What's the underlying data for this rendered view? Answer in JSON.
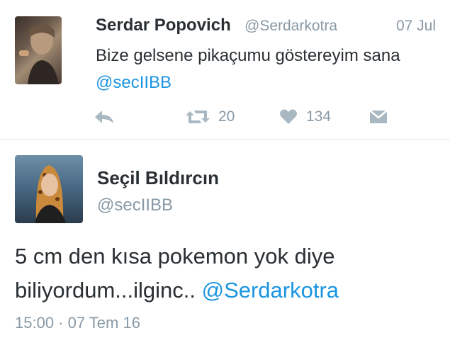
{
  "tweet1": {
    "name": "Serdar Popovich",
    "handle": "@Serdarkotra",
    "date": "07 Jul",
    "text_main": "Bize gelsene pikaçumu göstereyim sana ",
    "mention": "@secIIBB",
    "retweets": "20",
    "likes": "134",
    "icons": {
      "reply": "reply-icon",
      "retweet": "retweet-icon",
      "like": "heart-icon",
      "dm": "envelope-icon"
    }
  },
  "tweet2": {
    "name": "Seçil Bıldırcın",
    "handle": "@secIIBB",
    "text_main": "5 cm den kısa pokemon yok diye biliyordum...ilginc.. ",
    "mention": "@Serdarkotra",
    "timestamp": "15:00 · 07 Tem 16"
  },
  "colors": {
    "text": "#292f33",
    "muted": "#8899a6",
    "link": "#1b95e0",
    "divider": "#e1e8ed"
  }
}
